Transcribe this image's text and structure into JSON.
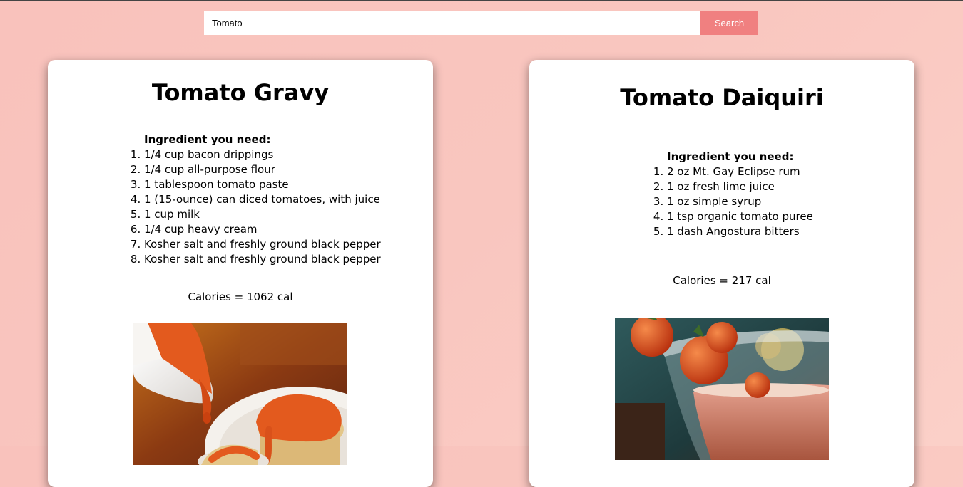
{
  "search": {
    "value": "Tomato",
    "placeholder": "",
    "button_label": "Search"
  },
  "recipes": [
    {
      "title": "Tomato Gravy",
      "ingredients_heading": "Ingredient you need:",
      "ingredients": [
        "1/4 cup bacon drippings",
        "1/4 cup all-purpose flour",
        "1 tablespoon tomato paste",
        "1 (15-ounce) can diced tomatoes, with juice",
        "1 cup milk",
        "1/4 cup heavy cream",
        "Kosher salt and freshly ground black pepper",
        "Kosher salt and freshly ground black pepper"
      ],
      "calories": "Calories = 1062 cal"
    },
    {
      "title": "Tomato Daiquiri",
      "ingredients_heading": "Ingredient you need:",
      "ingredients": [
        "2 oz Mt. Gay Eclipse rum",
        "1 oz fresh lime juice",
        "1 oz simple syrup",
        "1 tsp organic tomato puree",
        "1 dash Angostura bitters"
      ],
      "calories": "Calories = 217 cal"
    }
  ],
  "colors": {
    "background": "#f9c4bd",
    "search_button": "#f08080",
    "card": "#ffffff"
  }
}
